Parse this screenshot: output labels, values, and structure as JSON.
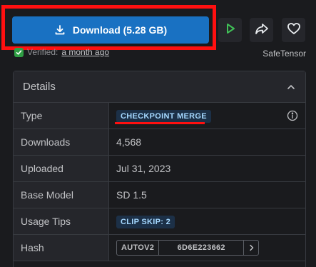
{
  "toolbar": {
    "download_label": "Download (5.28 GB)",
    "verified_label": "Verified:",
    "verified_time": "a month ago",
    "safetensor_label": "SafeTensor",
    "icons": {
      "download": "download-icon",
      "play": "play-icon",
      "share": "share-icon",
      "heart": "heart-icon"
    }
  },
  "details": {
    "title": "Details",
    "rows": {
      "type": {
        "key": "Type",
        "value": "CHECKPOINT MERGE"
      },
      "downloads": {
        "key": "Downloads",
        "value": "4,568"
      },
      "uploaded": {
        "key": "Uploaded",
        "value": "Jul 31, 2023"
      },
      "base_model": {
        "key": "Base Model",
        "value": "SD 1.5"
      },
      "usage_tips": {
        "key": "Usage Tips",
        "value": "CLIP SKIP: 2"
      },
      "hash": {
        "key": "Hash",
        "algo": "AUTOV2",
        "value": "6D6E223662"
      }
    }
  },
  "colors": {
    "primary": "#1971c2",
    "play_accent": "#40c057",
    "highlight": "#ff1010",
    "badge_text": "#a5d8ff"
  }
}
